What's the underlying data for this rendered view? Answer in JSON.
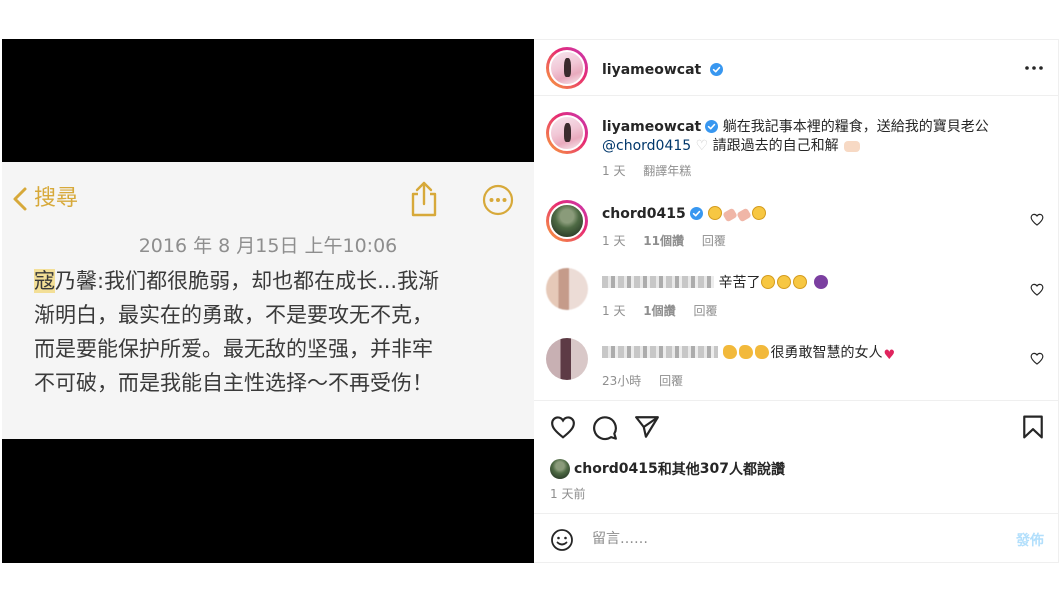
{
  "note": {
    "back_label": "搜尋",
    "date": "2016 年 8 月15日 上午10:06",
    "highlight": "寇",
    "lines": [
      "乃馨:我们都很脆弱，却也都在成长...我渐",
      "渐明白，最实在的勇敢，不是要攻无不克，",
      "而是要能保护所爱。最无敌的坚强，并非牢",
      "不可破，而是我能自主性选择～不再受伤！"
    ],
    "accent_color": "#d7a93a"
  },
  "post": {
    "author": "liyameowcat",
    "caption": {
      "username": "liyameowcat",
      "text": "躺在我記事本裡的糧食，送給我的寶貝老公",
      "mention": "@chord0415",
      "text2": "請跟過去的自己和解",
      "time": "1 天",
      "translate": "翻譯年糕"
    },
    "comments": [
      {
        "username": "chord0415",
        "time": "1 天",
        "likes": "11個讚",
        "reply": "回覆"
      },
      {
        "text": "辛苦了",
        "time": "1 天",
        "likes": "1個讚",
        "reply": "回覆"
      },
      {
        "text": "很勇敢智慧的女人",
        "time": "23小時",
        "reply": "回覆"
      }
    ],
    "liked_by": {
      "user": "chord0415",
      "others": "和其他",
      "count": "307",
      "suffix": "人都說讚"
    },
    "posted_ago": "1 天前",
    "composer": {
      "placeholder": "留言……",
      "post_label": "發佈"
    },
    "verified_color": "#3897f0"
  }
}
